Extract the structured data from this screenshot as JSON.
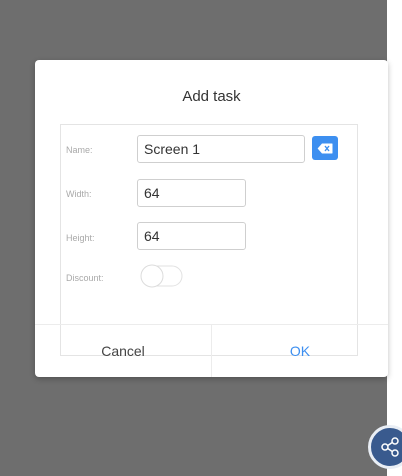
{
  "dialog": {
    "title": "Add task",
    "fields": {
      "name": {
        "label": "Name:",
        "value": "Screen 1"
      },
      "width": {
        "label": "Width:",
        "value": "64"
      },
      "height": {
        "label": "Height:",
        "value": "64"
      },
      "discount": {
        "label": "Discount:",
        "enabled": false
      }
    },
    "buttons": {
      "cancel": "Cancel",
      "ok": "OK"
    }
  },
  "colors": {
    "accent": "#3d8ff0",
    "backdrop": "#6e6e6e",
    "fab": "#395a8e"
  },
  "icons": {
    "clear": "backspace-clear-icon",
    "fab": "share-nodes-icon"
  }
}
